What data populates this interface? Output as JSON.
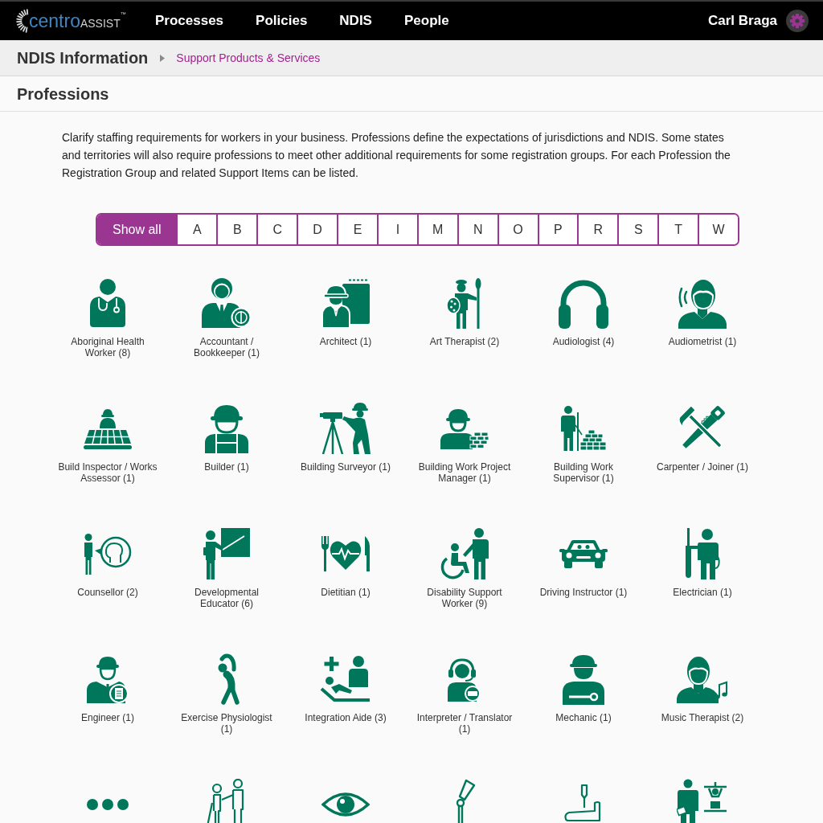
{
  "header": {
    "logo": {
      "part_1": "centro",
      "part_2": "ASSIST",
      "mark": "™"
    },
    "nav": [
      "Processes",
      "Policies",
      "NDIS",
      "People"
    ],
    "user_name": "Carl Braga"
  },
  "breadcrumb": {
    "title": "NDIS Information",
    "link": "Support Products & Services"
  },
  "page": {
    "heading": "Professions",
    "intro": "Clarify staffing requirements for workers in your business. Professions define the expectations of jurisdictions and NDIS. Some states and territories will also require professions to meet other additional requirements for some registration groups. For each Profession the Registration Group and related Support Items can be listed."
  },
  "filters": [
    {
      "label": "Show all",
      "selected": true
    },
    {
      "label": "A",
      "selected": false
    },
    {
      "label": "B",
      "selected": false
    },
    {
      "label": "C",
      "selected": false
    },
    {
      "label": "D",
      "selected": false
    },
    {
      "label": "E",
      "selected": false
    },
    {
      "label": "I",
      "selected": false
    },
    {
      "label": "M",
      "selected": false
    },
    {
      "label": "N",
      "selected": false
    },
    {
      "label": "O",
      "selected": false
    },
    {
      "label": "P",
      "selected": false
    },
    {
      "label": "R",
      "selected": false
    },
    {
      "label": "S",
      "selected": false
    },
    {
      "label": "T",
      "selected": false
    },
    {
      "label": "W",
      "selected": false
    }
  ],
  "professions": [
    {
      "kind": "labelled",
      "label": "Aboriginal Health Worker (8)"
    },
    {
      "kind": "labelled",
      "label": "Accountant / Bookkeeper (1)"
    },
    {
      "kind": "labelled",
      "label": "Architect (1)"
    },
    {
      "kind": "labelled",
      "label": "Art Therapist (2)"
    },
    {
      "kind": "labelled",
      "label": "Audiologist (4)"
    },
    {
      "kind": "labelled",
      "label": "Audiometrist (1)"
    },
    {
      "kind": "labelled",
      "label": "Build Inspector / Works Assessor (1)"
    },
    {
      "kind": "labelled",
      "label": "Builder (1)"
    },
    {
      "kind": "labelled",
      "label": "Building Surveyor (1)"
    },
    {
      "kind": "labelled",
      "label": "Building Work Project Manager (1)"
    },
    {
      "kind": "labelled",
      "label": "Building Work Supervisor (1)"
    },
    {
      "kind": "labelled",
      "label": "Carpenter / Joiner (1)"
    },
    {
      "kind": "labelled",
      "label": "Counsellor (2)"
    },
    {
      "kind": "labelled",
      "label": "Developmental Educator (6)"
    },
    {
      "kind": "labelled",
      "label": "Dietitian (1)"
    },
    {
      "kind": "labelled",
      "label": "Disability Support Worker (9)"
    },
    {
      "kind": "labelled",
      "label": "Driving Instructor (1)"
    },
    {
      "kind": "labelled",
      "label": "Electrician (1)"
    },
    {
      "kind": "labelled",
      "label": "Engineer (1)"
    },
    {
      "kind": "labelled",
      "label": "Exercise Physiologist (1)"
    },
    {
      "kind": "labelled",
      "label": "Integration Aide (3)"
    },
    {
      "kind": "labelled",
      "label": "Interpreter / Translator (1)"
    },
    {
      "kind": "labelled",
      "label": "Mechanic (1)"
    },
    {
      "kind": "labelled",
      "label": "Music Therapist (2)"
    },
    {
      "kind": "clipped"
    },
    {
      "kind": "clipped"
    },
    {
      "kind": "clipped"
    },
    {
      "kind": "clipped"
    },
    {
      "kind": "clipped"
    },
    {
      "kind": "clipped"
    }
  ]
}
